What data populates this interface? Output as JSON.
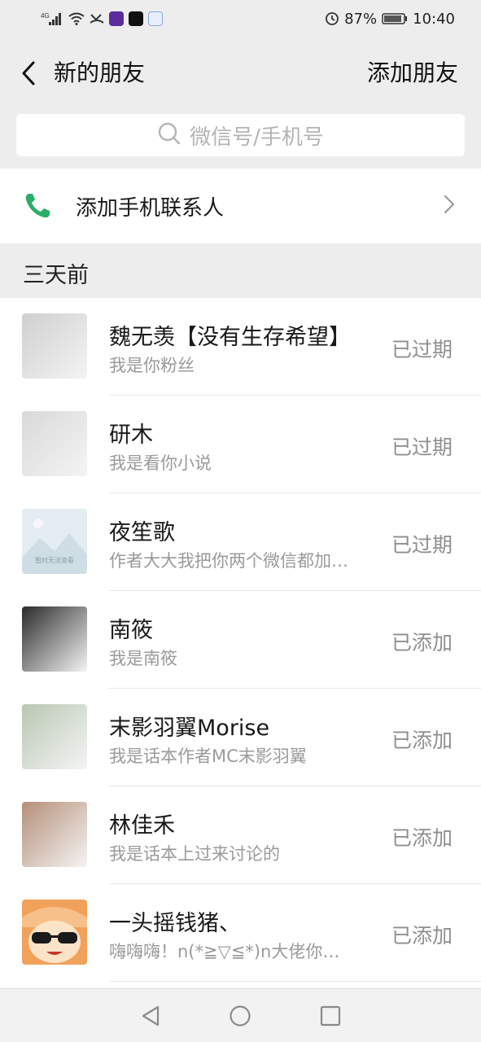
{
  "status_bar": {
    "network": "4G",
    "battery": "87%",
    "time": "10:40",
    "icons": [
      "signal-icon",
      "wifi-icon",
      "missed-call-icon",
      "app-icon",
      "tiktok-icon",
      "baidu-icon"
    ]
  },
  "nav": {
    "title": "新的朋友",
    "action_label": "添加朋友"
  },
  "search": {
    "placeholder": "微信号/手机号"
  },
  "phone_contacts": {
    "label": "添加手机联系人"
  },
  "section": {
    "title": "三天前"
  },
  "requests": [
    {
      "name": "魏无羡【没有生存希望】",
      "message": "我是你粉丝",
      "status": "已过期",
      "avatar_color": "#cfcfcf"
    },
    {
      "name": "研木",
      "message": "我是看你小说",
      "status": "已过期",
      "avatar_color": "#d9d9d9"
    },
    {
      "name": "夜笙歌",
      "message": "作者大大我把你两个微信都加…",
      "status": "已过期",
      "avatar_color": "#dfeaf0"
    },
    {
      "name": "南筱",
      "message": "我是南筱",
      "status": "已添加",
      "avatar_color": "#2a2a2a"
    },
    {
      "name": "末影羽翼Morise",
      "message": "我是话本作者MC末影羽翼",
      "status": "已添加",
      "avatar_color": "#b9c7b2"
    },
    {
      "name": "林佳禾",
      "message": "我是话本上过来讨论的",
      "status": "已添加",
      "avatar_color": "#b58f78"
    },
    {
      "name": "一头摇钱猪、",
      "message": "嗨嗨嗨！n(*≧▽≦*)n大佬你…",
      "status": "已添加",
      "avatar_color": "#f2a15a"
    }
  ],
  "avatar_placeholder_text": "暂时无法查看",
  "colors": {
    "background": "#ededed",
    "phone_icon": "#2aae67",
    "secondary_text": "#9a9a9a"
  }
}
